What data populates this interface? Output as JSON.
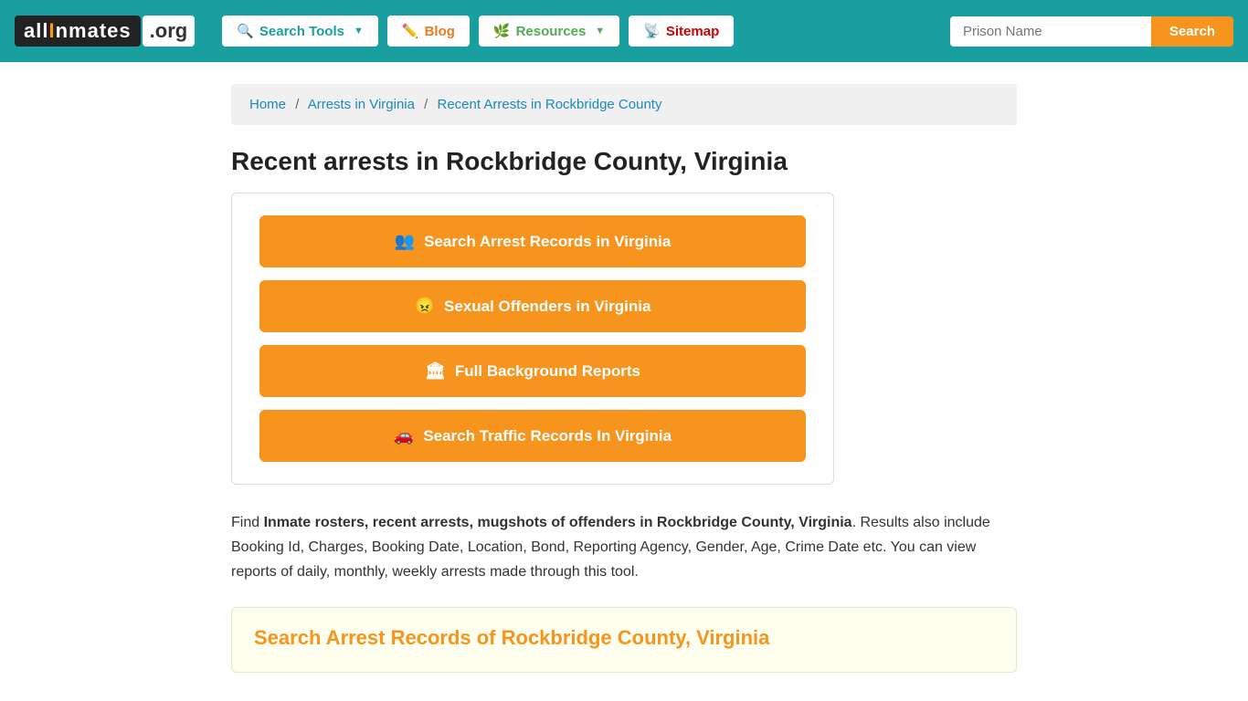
{
  "navbar": {
    "logo_text": "allInmates",
    "logo_org": ".org",
    "nav_items": [
      {
        "id": "search-tools",
        "label": "Search Tools",
        "icon": "🔍",
        "has_caret": true
      },
      {
        "id": "blog",
        "label": "Blog",
        "icon": "✏️",
        "has_caret": false
      },
      {
        "id": "resources",
        "label": "Resources",
        "icon": "🌿",
        "has_caret": true
      },
      {
        "id": "sitemap",
        "label": "Sitemap",
        "icon": "📡",
        "has_caret": false
      }
    ],
    "search_placeholder": "Prison Name",
    "search_btn_label": "Search"
  },
  "breadcrumb": {
    "home": "Home",
    "arrests": "Arrests in Virginia",
    "current": "Recent Arrests in Rockbridge County"
  },
  "page": {
    "title": "Recent arrests in Rockbridge County, Virginia",
    "buttons": [
      {
        "id": "arrest-records",
        "icon": "👥",
        "label": "Search Arrest Records in Virginia"
      },
      {
        "id": "sexual-offenders",
        "icon": "😠",
        "label": "Sexual Offenders in Virginia"
      },
      {
        "id": "background-reports",
        "icon": "🏛",
        "label": "Full Background Reports"
      },
      {
        "id": "traffic-records",
        "icon": "🚗",
        "label": "Search Traffic Records In Virginia"
      }
    ],
    "description_prefix": "Find ",
    "description_bold": "Inmate rosters, recent arrests, mugshots of offenders in Rockbridge County, Virginia",
    "description_rest": ". Results also include Booking Id, Charges, Booking Date, Location, Bond, Reporting Agency, Gender, Age, Crime Date etc. You can view reports of daily, monthly, weekly arrests made through this tool.",
    "search_section_title": "Search Arrest Records of Rockbridge County, Virginia"
  }
}
